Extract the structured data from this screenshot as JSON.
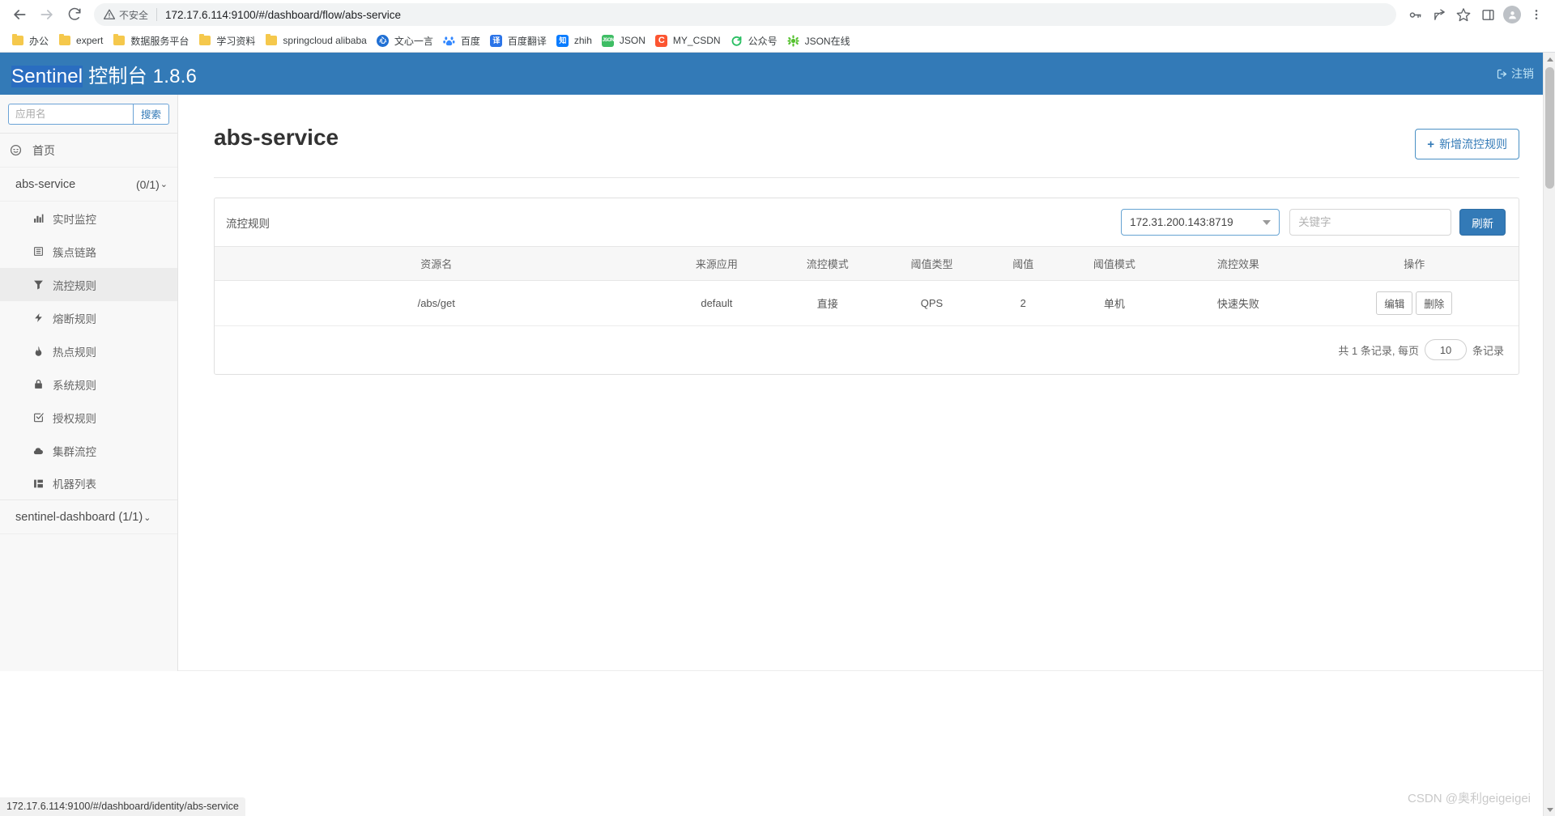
{
  "browser": {
    "back_icon": "arrow-left-icon",
    "forward_icon": "arrow-right-icon",
    "reload_icon": "reload-icon",
    "security_label": "不安全",
    "url": "172.17.6.114:9100/#/dashboard/flow/abs-service",
    "right_icons": [
      "key-icon",
      "share-icon",
      "star-icon",
      "sidepanel-icon",
      "profile-icon",
      "menu-icon"
    ],
    "bookmarks": [
      {
        "label": "办公",
        "icon": "folder-icon",
        "type": "folder"
      },
      {
        "label": "expert",
        "icon": "folder-icon",
        "type": "folder"
      },
      {
        "label": "数据服务平台",
        "icon": "folder-icon",
        "type": "folder"
      },
      {
        "label": "学习资料",
        "icon": "folder-icon",
        "type": "folder"
      },
      {
        "label": "springcloud alibaba",
        "icon": "folder-icon",
        "type": "folder"
      },
      {
        "label": "文心一言",
        "icon": "wenxin-icon",
        "type": "site",
        "color": "#1f6fd4",
        "glyph": "心"
      },
      {
        "label": "百度",
        "icon": "baidu-icon",
        "type": "site",
        "color": "#3388ff",
        "glyph": "熊"
      },
      {
        "label": "百度翻译",
        "icon": "fanyi-icon",
        "type": "site",
        "color": "#2b74e8",
        "glyph": "译"
      },
      {
        "label": "zhih",
        "icon": "zhihu-icon",
        "type": "site",
        "color": "#0a7cff",
        "glyph": "知"
      },
      {
        "label": "JSON",
        "icon": "json-icon",
        "type": "site",
        "color": "#3ebd64",
        "glyph": "J"
      },
      {
        "label": "MY_CSDN",
        "icon": "csdn-icon",
        "type": "site",
        "color": "#fc5531",
        "glyph": "C"
      },
      {
        "label": "公众号",
        "icon": "wechat-mp-icon",
        "type": "site",
        "color": "#2bbf63",
        "glyph": "S"
      },
      {
        "label": "JSON在线",
        "icon": "json-online-icon",
        "type": "site",
        "color": "#55c12f",
        "glyph": "✲"
      }
    ]
  },
  "app": {
    "brand_highlight": "Sentinel",
    "brand_rest": " 控制台 1.8.6",
    "logout_label": "注销",
    "logout_icon": "logout-icon"
  },
  "sidebar": {
    "search": {
      "placeholder": "应用名",
      "value": "",
      "button_label": "搜索"
    },
    "home": {
      "label": "首页",
      "icon": "clock-icon"
    },
    "groups": [
      {
        "name": "abs-service",
        "count": "(0/1)",
        "caret": "⌄",
        "items": [
          {
            "label": "实时监控",
            "icon": "bar-chart-icon",
            "active": false
          },
          {
            "label": "簇点链路",
            "icon": "list-icon",
            "active": false
          },
          {
            "label": "流控规则",
            "icon": "filter-icon",
            "active": true
          },
          {
            "label": "熔断规则",
            "icon": "bolt-icon",
            "active": false
          },
          {
            "label": "热点规则",
            "icon": "fire-icon",
            "active": false
          },
          {
            "label": "系统规则",
            "icon": "lock-icon",
            "active": false
          },
          {
            "label": "授权规则",
            "icon": "check-square-icon",
            "active": false
          },
          {
            "label": "集群流控",
            "icon": "cloud-icon",
            "active": false
          },
          {
            "label": "机器列表",
            "icon": "grid-icon",
            "active": false
          }
        ]
      },
      {
        "name": "sentinel-dashboard",
        "count": "(1/1)",
        "caret": "⌄",
        "items": []
      }
    ]
  },
  "main": {
    "page_title": "abs-service",
    "add_rule_button": "新增流控规则",
    "add_rule_plus": "+",
    "panel_title": "流控规则",
    "machine_select": {
      "value": "172.31.200.143:8719",
      "icon": "chevron-down-icon"
    },
    "keyword_input": {
      "value": "",
      "placeholder": "关键字"
    },
    "refresh_button": "刷新",
    "table": {
      "columns": [
        "资源名",
        "来源应用",
        "流控模式",
        "阈值类型",
        "阈值",
        "阈值模式",
        "流控效果",
        "操作"
      ],
      "rows": [
        {
          "resource": "/abs/get",
          "origin": "default",
          "mode": "直接",
          "grade": "QPS",
          "count": "2",
          "cluster_mode": "单机",
          "control_behavior": "快速失败",
          "edit_label": "编辑",
          "delete_label": "删除"
        }
      ]
    },
    "pagination": {
      "prefix": "共 1 条记录, 每页",
      "page_size": "10",
      "suffix": "条记录"
    }
  },
  "statusbar": {
    "link_preview": "172.17.6.114:9100/#/dashboard/identity/abs-service"
  },
  "watermark": "CSDN @奥利geigeigei",
  "colors": {
    "header_blue": "#337ab7",
    "accent_blue": "#337ab7",
    "sidebar_bg": "#f8f8f8"
  }
}
